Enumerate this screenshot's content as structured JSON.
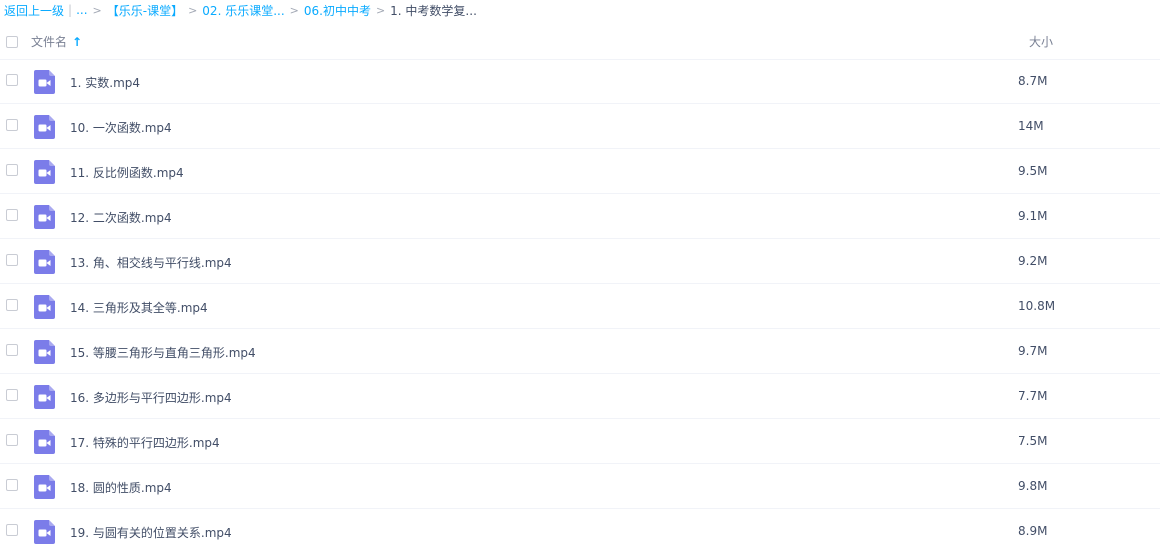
{
  "breadcrumb": {
    "back": "返回上一级",
    "ellipsis": "...",
    "items": [
      "【乐乐-课堂】",
      "02. 乐乐课堂...",
      "06.初中中考"
    ],
    "current": "1. 中考数学复..."
  },
  "header": {
    "name_col": "文件名",
    "size_col": "大小"
  },
  "icons": {
    "file_icon": "video-file-icon",
    "file_icon_color": "#7b7ce9",
    "sort_icon": "arrow-up-icon"
  },
  "files": [
    {
      "name": "1. 实数.mp4",
      "size": "8.7M"
    },
    {
      "name": "10. 一次函数.mp4",
      "size": "14M"
    },
    {
      "name": "11. 反比例函数.mp4",
      "size": "9.5M"
    },
    {
      "name": "12. 二次函数.mp4",
      "size": "9.1M"
    },
    {
      "name": "13. 角、相交线与平行线.mp4",
      "size": "9.2M"
    },
    {
      "name": "14. 三角形及其全等.mp4",
      "size": "10.8M"
    },
    {
      "name": "15. 等腰三角形与直角三角形.mp4",
      "size": "9.7M"
    },
    {
      "name": "16. 多边形与平行四边形.mp4",
      "size": "7.7M"
    },
    {
      "name": "17. 特殊的平行四边形.mp4",
      "size": "7.5M"
    },
    {
      "name": "18. 圆的性质.mp4",
      "size": "9.8M"
    },
    {
      "name": "19. 与圆有关的位置关系.mp4",
      "size": "8.9M"
    }
  ]
}
